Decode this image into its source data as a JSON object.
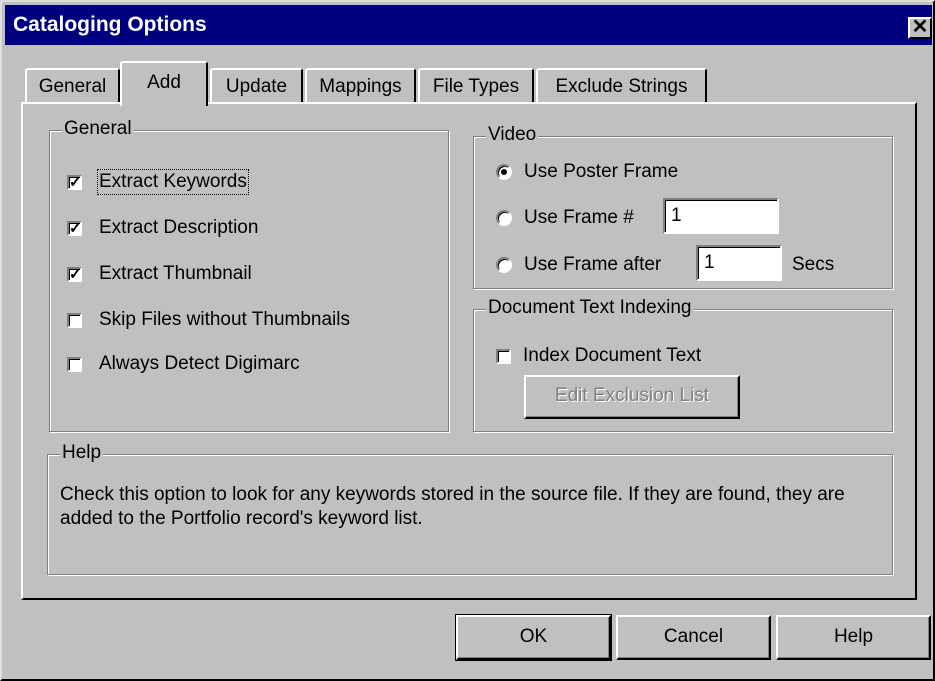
{
  "window": {
    "title": "Cataloging Options",
    "close_glyph": "✕"
  },
  "tabs": [
    {
      "label": "General",
      "active": false
    },
    {
      "label": "Add",
      "active": true
    },
    {
      "label": "Update",
      "active": false
    },
    {
      "label": "Mappings",
      "active": false
    },
    {
      "label": "File Types",
      "active": false
    },
    {
      "label": "Exclude Strings",
      "active": false
    }
  ],
  "general_group": {
    "label": "General",
    "options": [
      {
        "text": "Extract Keywords",
        "checked": true
      },
      {
        "text": "Extract Description",
        "checked": true
      },
      {
        "text": "Extract Thumbnail",
        "checked": true
      },
      {
        "text": "Skip Files without Thumbnails",
        "checked": false
      },
      {
        "text": "Always Detect Digimarc",
        "checked": false
      }
    ]
  },
  "video_group": {
    "label": "Video",
    "options": [
      {
        "text": "Use Poster Frame",
        "selected": true
      },
      {
        "text": "Use Frame #",
        "selected": false,
        "value": "1"
      },
      {
        "text": "Use Frame after",
        "selected": false,
        "value": "1",
        "suffix": "Secs"
      }
    ]
  },
  "doc_group": {
    "label": "Document Text Indexing",
    "checkbox": {
      "text": "Index Document Text",
      "checked": false
    },
    "button": "Edit Exclusion List"
  },
  "help_group": {
    "label": "Help",
    "text": "Check this option to look for any keywords stored in the source file. If they are found, they are added to the Portfolio record's keyword list."
  },
  "footer": {
    "ok": "OK",
    "cancel": "Cancel",
    "help": "Help"
  }
}
